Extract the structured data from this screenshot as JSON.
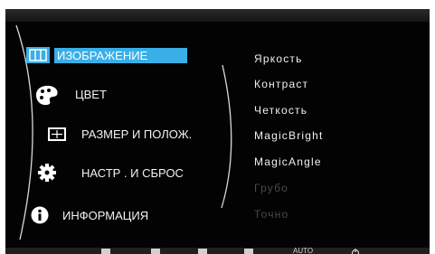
{
  "main_menu": {
    "items": [
      {
        "label": "ИЗОБРАЖЕНИЕ",
        "icon": "picture-icon",
        "selected": true
      },
      {
        "label": "ЦВЕТ",
        "icon": "palette-icon",
        "selected": false
      },
      {
        "label": "РАЗМЕР И ПОЛОЖ.",
        "icon": "size-position-icon",
        "selected": false
      },
      {
        "label": "НАСТР . И СБРОС",
        "icon": "gear-icon",
        "selected": false
      },
      {
        "label": "ИНФОРМАЦИЯ",
        "icon": "info-icon",
        "selected": false
      }
    ]
  },
  "sub_menu": {
    "items": [
      {
        "label": "Яркость",
        "enabled": true
      },
      {
        "label": "Контраст",
        "enabled": true
      },
      {
        "label": "Четкость",
        "enabled": true
      },
      {
        "label": "MagicBright",
        "enabled": true
      },
      {
        "label": "MagicAngle",
        "enabled": true
      },
      {
        "label": "Грубо",
        "enabled": false
      },
      {
        "label": "Точно",
        "enabled": false
      }
    ]
  },
  "bottom_bar": {
    "auto_label": "AUTO"
  },
  "colors": {
    "background": "#030303",
    "selected_highlight": "#39aee7",
    "text": "#f2f2f2",
    "disabled_text": "#4a4a4a"
  }
}
